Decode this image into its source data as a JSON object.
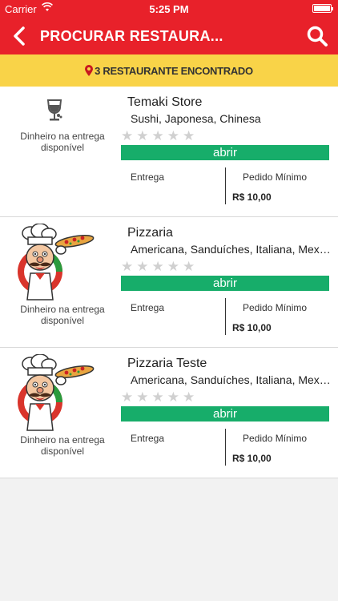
{
  "status_bar": {
    "carrier": "Carrier",
    "time": "5:25 PM"
  },
  "nav": {
    "title": "PROCURAR RESTAURA...",
    "back_icon": "chevron-left-icon",
    "search_icon": "search-icon"
  },
  "banner": {
    "text": "3 RESTAURANTE ENCONTRADO"
  },
  "colors": {
    "primary": "#e8212a",
    "banner": "#f9d348",
    "open": "#17ad6a",
    "star_empty": "#d0d0d0"
  },
  "restaurants": [
    {
      "name": "Temaki Store",
      "cuisine": "Sushi, Japonesa, Chinesa",
      "logo": "wine-glass-icon",
      "rating": 0,
      "payment": "Dinheiro na entrega disponível",
      "open_label": "abrir",
      "delivery_label": "Entrega",
      "min_order_label": "Pedido Mínimo",
      "min_order_value": "R$ 10,00"
    },
    {
      "name": "Pizzaria",
      "cuisine": "Americana, Sanduíches, Italiana, Mexicana",
      "logo": "pizza-chef-logo",
      "rating": 0,
      "payment": "Dinheiro na entrega disponível",
      "open_label": "abrir",
      "delivery_label": "Entrega",
      "min_order_label": "Pedido Mínimo",
      "min_order_value": "R$ 10,00"
    },
    {
      "name": "Pizzaria Teste",
      "cuisine": "Americana, Sanduíches, Italiana, Mexicana",
      "logo": "pizza-chef-logo",
      "rating": 0,
      "payment": "Dinheiro na entrega disponível",
      "open_label": "abrir",
      "delivery_label": "Entrega",
      "min_order_label": "Pedido Mínimo",
      "min_order_value": "R$ 10,00"
    }
  ]
}
